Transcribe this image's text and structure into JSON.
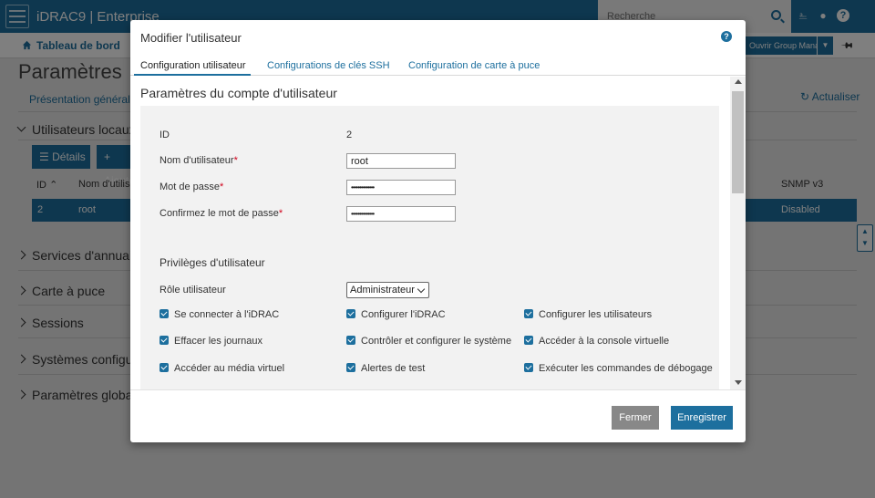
{
  "app": {
    "brand": "iDRAC9 | Enterprise",
    "search_placeholder": "Recherche",
    "nav_home": "Tableau de bord",
    "group_manager": "Ouvrir Group Manager",
    "page_title": "Paramètres",
    "sub_tab": "Présentation générale",
    "refresh": "Actualiser"
  },
  "background": {
    "sections": [
      "Utilisateurs locaux",
      "Services d'annuaire",
      "Carte à puce",
      "Sessions",
      "Systèmes configurés",
      "Paramètres globaux"
    ],
    "details_button": "Détails",
    "add_button": "Ajouter",
    "table_headers": [
      "ID",
      "Nom d'utilisateur",
      "SNMP v3"
    ],
    "row": {
      "id": "2",
      "name": "root",
      "snmp": "Disabled"
    }
  },
  "modal": {
    "title": "Modifier l'utilisateur",
    "tabs": [
      {
        "label": "Configuration utilisateur",
        "active": true
      },
      {
        "label": "Configurations de clés SSH",
        "active": false
      },
      {
        "label": "Configuration de carte à puce",
        "active": false
      }
    ],
    "section_title": "Paramètres du compte d'utilisateur",
    "fields": {
      "id_label": "ID",
      "id_value": "2",
      "username_label": "Nom d'utilisateur",
      "username_value": "root",
      "password_label": "Mot de passe",
      "password_value": "••••••••••••••",
      "confirm_label": "Confirmez le mot de passe",
      "confirm_value": "••••••••••••••",
      "required_mark": "*"
    },
    "privileges": {
      "title": "Privilèges d'utilisateur",
      "role_label": "Rôle utilisateur",
      "role_value": "Administrateur",
      "items": [
        {
          "label": "Se connecter à l'iDRAC",
          "checked": true
        },
        {
          "label": "Configurer l'iDRAC",
          "checked": true
        },
        {
          "label": "Configurer les utilisateurs",
          "checked": true
        },
        {
          "label": "Effacer les journaux",
          "checked": true
        },
        {
          "label": "Contrôler et configurer le système",
          "checked": true
        },
        {
          "label": "Accéder à la console virtuelle",
          "checked": true
        },
        {
          "label": "Accéder au média virtuel",
          "checked": true
        },
        {
          "label": "Alertes de test",
          "checked": true
        },
        {
          "label": "Exécuter les commandes de débogage",
          "checked": true
        }
      ]
    },
    "buttons": {
      "close": "Fermer",
      "save": "Enregistrer"
    }
  },
  "colors": {
    "accent": "#1d6f9e",
    "required": "#d0021b",
    "close_button": "#888888"
  }
}
